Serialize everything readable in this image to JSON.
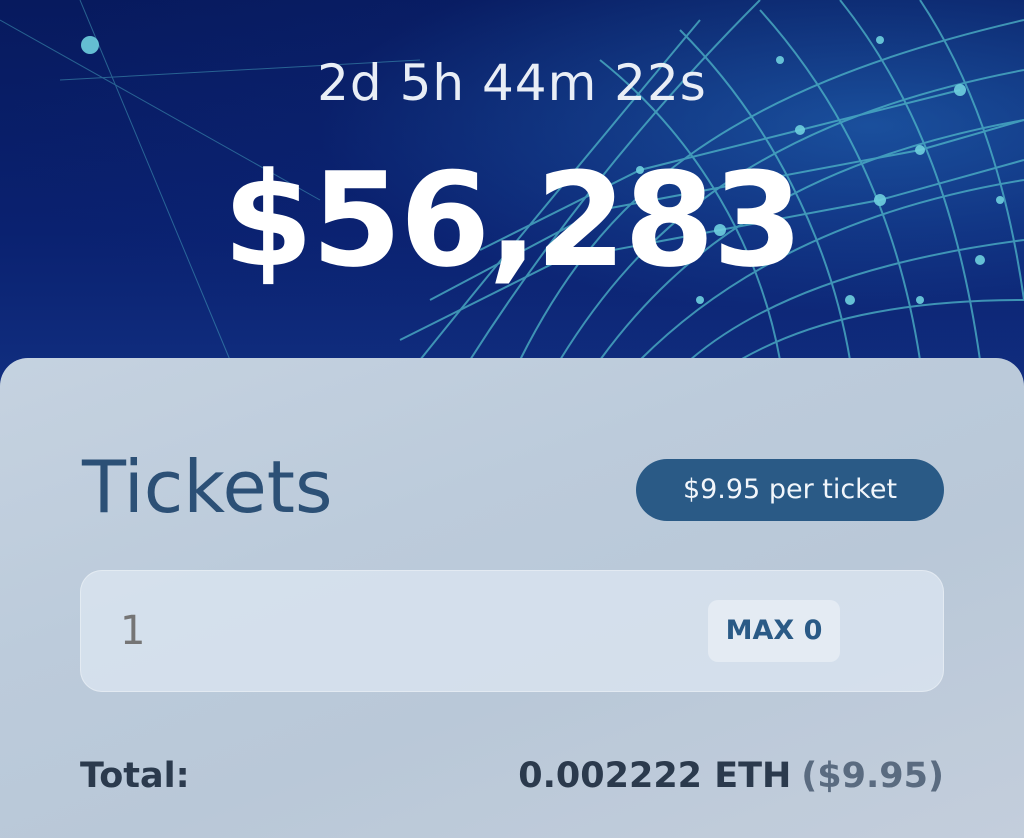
{
  "hero": {
    "countdown": "2d 5h 44m 22s",
    "jackpot": "$56,283"
  },
  "tickets": {
    "title": "Tickets",
    "price_label": "$9.95 per ticket",
    "quantity_placeholder": "1",
    "max_label": "MAX 0"
  },
  "total": {
    "label": "Total:",
    "eth": "0.002222 ETH",
    "usd": "($9.95)"
  },
  "colors": {
    "accent": "#2a5a86",
    "hero_background": "#0a2170",
    "panel_background": "#bccbdb"
  }
}
